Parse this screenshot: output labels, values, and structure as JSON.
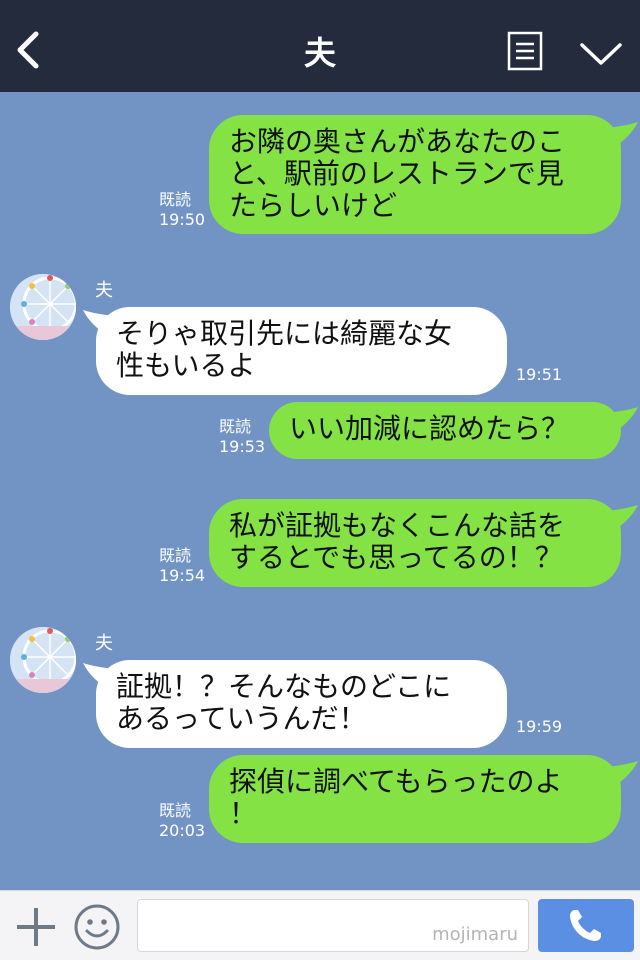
{
  "header": {
    "title": "夫"
  },
  "messages": [
    {
      "type": "sent",
      "lines": [
        "お隣の奥さんがあなたのこ",
        "と、駅前のレストランで見",
        "たらしいけど"
      ],
      "read": "既読",
      "time": "19:50"
    },
    {
      "type": "received",
      "sender": "夫",
      "lines": [
        "そりゃ取引先には綺麗な女",
        "性もいるよ"
      ],
      "time": "19:51"
    },
    {
      "type": "sent",
      "lines": [
        "いい加減に認めたら？"
      ],
      "read": "既読",
      "time": "19:53"
    },
    {
      "type": "sent",
      "lines": [
        "私が証拠もなくこんな話を",
        "するとでも思ってるの！？"
      ],
      "read": "既読",
      "time": "19:54"
    },
    {
      "type": "received",
      "sender": "夫",
      "lines": [
        "証拠！？そんなものどこに",
        "あるっていうんだ！"
      ],
      "time": "19:59"
    },
    {
      "type": "sent",
      "lines": [
        "探偵に調べてもらったのよ",
        "！"
      ],
      "read": "既読",
      "time": "20:03"
    }
  ],
  "footer": {
    "input_value": "",
    "watermark": "mojimaru"
  },
  "colors": {
    "header_bg": "#232b3d",
    "chat_bg": "#7294c4",
    "sent_bubble": "#84e245",
    "received_bubble": "#ffffff",
    "call_button": "#5b8fe3"
  },
  "icons": [
    "back-icon",
    "menu-icon",
    "chevron-down-icon",
    "plus-icon",
    "emoji-icon",
    "phone-icon"
  ]
}
